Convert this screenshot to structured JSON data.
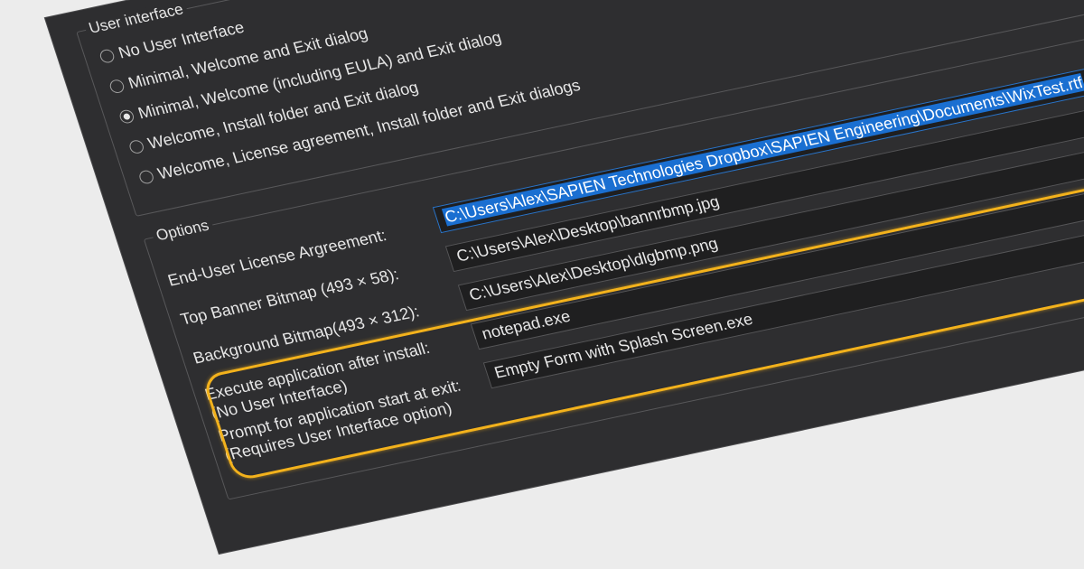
{
  "user_interface": {
    "group_label": "User interface",
    "options": [
      {
        "label": "No User Interface",
        "checked": false
      },
      {
        "label": "Minimal, Welcome and Exit dialog",
        "checked": false
      },
      {
        "label": "Minimal, Welcome (including EULA) and Exit dialog",
        "checked": true
      },
      {
        "label": "Welcome, Install folder and Exit dialog",
        "checked": false
      },
      {
        "label": "Welcome, License agreement, Install folder and Exit dialogs",
        "checked": false
      }
    ]
  },
  "options": {
    "group_label": "Options",
    "eula_label": "End-User License Argreement:",
    "eula_value": "C:\\Users\\Alex\\SAPIEN Technologies Dropbox\\SAPIEN Engineering\\Documents\\WixTest.rtf",
    "banner_label": "Top Banner Bitmap (493 × 58):",
    "banner_value": "C:\\Users\\Alex\\Desktop\\bannrbmp.jpg",
    "background_label": "Background Bitmap(493 × 312):",
    "background_value": "C:\\Users\\Alex\\Desktop\\dlgbmp.png",
    "execute_label_line1": "Execute application after install:",
    "execute_label_line2": "(No User Interface)",
    "execute_value": "notepad.exe",
    "prompt_label_line1": "Prompt for application start at exit:",
    "prompt_label_line2": "(Requires User Interface option)",
    "prompt_value": "Empty Form with Splash Screen.exe"
  },
  "colors": {
    "panel": "#2e2e30",
    "highlight_outline": "#f3b21c",
    "selection": "#1a6fd1"
  }
}
